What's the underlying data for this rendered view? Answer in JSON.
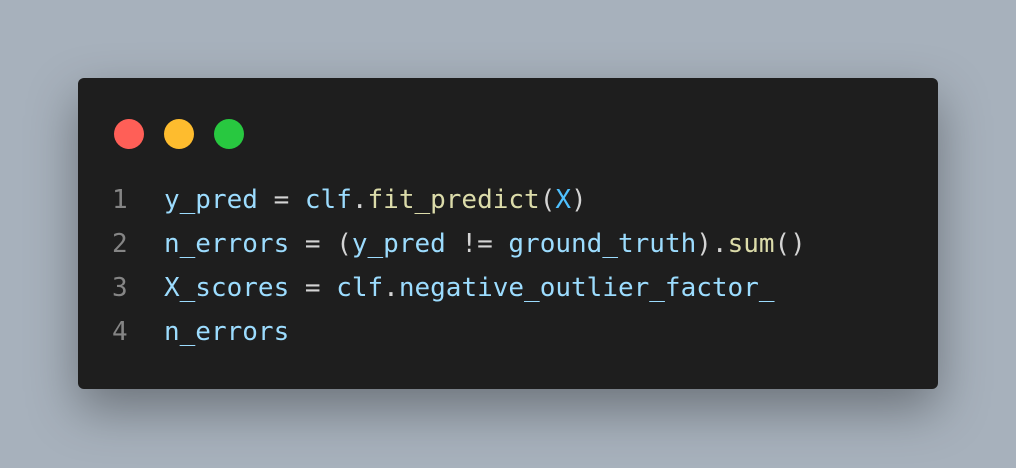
{
  "window": {
    "buttons": [
      {
        "name": "close",
        "color": "#ff5f57"
      },
      {
        "name": "minimize",
        "color": "#febc2e"
      },
      {
        "name": "maximize",
        "color": "#28c840"
      }
    ]
  },
  "code": {
    "lines": [
      {
        "number": "1",
        "tokens": [
          {
            "text": "y_pred",
            "kind": "var"
          },
          {
            "text": " = ",
            "kind": "op"
          },
          {
            "text": "clf",
            "kind": "var"
          },
          {
            "text": ".",
            "kind": "op"
          },
          {
            "text": "fit_predict",
            "kind": "fn"
          },
          {
            "text": "(",
            "kind": "paren"
          },
          {
            "text": "X",
            "kind": "const"
          },
          {
            "text": ")",
            "kind": "paren"
          }
        ]
      },
      {
        "number": "2",
        "tokens": [
          {
            "text": "n_errors",
            "kind": "var"
          },
          {
            "text": " = (",
            "kind": "op"
          },
          {
            "text": "y_pred",
            "kind": "var"
          },
          {
            "text": " != ",
            "kind": "op"
          },
          {
            "text": "ground_truth",
            "kind": "var"
          },
          {
            "text": ").",
            "kind": "op"
          },
          {
            "text": "sum",
            "kind": "fn"
          },
          {
            "text": "()",
            "kind": "paren"
          }
        ]
      },
      {
        "number": "3",
        "tokens": [
          {
            "text": "X_scores",
            "kind": "var"
          },
          {
            "text": " = ",
            "kind": "op"
          },
          {
            "text": "clf",
            "kind": "var"
          },
          {
            "text": ".",
            "kind": "op"
          },
          {
            "text": "negative_outlier_factor_",
            "kind": "var"
          }
        ]
      },
      {
        "number": "4",
        "tokens": [
          {
            "text": "n_errors",
            "kind": "var"
          }
        ]
      }
    ]
  }
}
